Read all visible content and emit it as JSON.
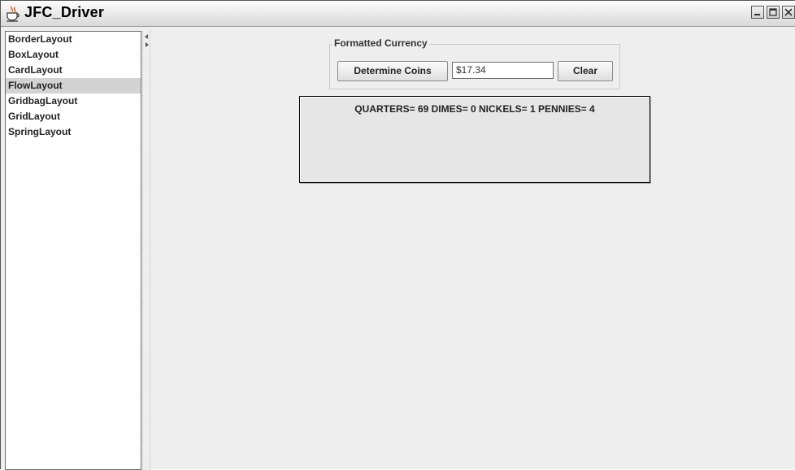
{
  "window": {
    "title": "JFC_Driver",
    "icon": "java-cup-icon",
    "controls": [
      "minimize-icon",
      "maximize-icon",
      "close-icon"
    ]
  },
  "sidebar": {
    "items": [
      {
        "label": "BorderLayout",
        "selected": false
      },
      {
        "label": "BoxLayout",
        "selected": false
      },
      {
        "label": "CardLayout",
        "selected": false
      },
      {
        "label": "FlowLayout",
        "selected": true
      },
      {
        "label": "GridbagLayout",
        "selected": false
      },
      {
        "label": "GridLayout",
        "selected": false
      },
      {
        "label": "SpringLayout",
        "selected": false
      }
    ]
  },
  "currency_panel": {
    "legend": "Formatted Currency",
    "determine_label": "Determine Coins",
    "amount_value": "$17.34",
    "clear_label": "Clear"
  },
  "result": {
    "text": "QUARTERS= 69 DIMES= 0 NICKELS= 1 PENNIES= 4"
  },
  "colors": {
    "background": "#eeeeee",
    "selection": "#d3d3d3",
    "output_background": "#e6e6e6"
  }
}
